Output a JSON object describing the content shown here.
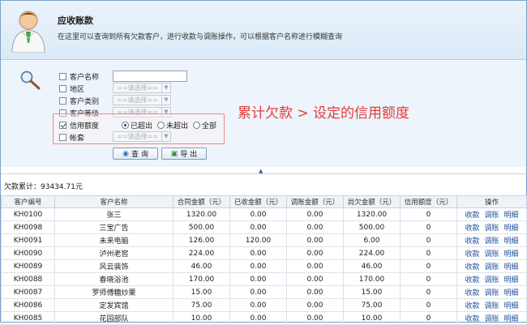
{
  "header": {
    "title": "应收账款",
    "description": "在这里可以查询到所有欠款客户，进行收款与调账操作，可以根据客户名称进行模糊查询"
  },
  "filters": {
    "customer_name_label": "客户名称",
    "region_label": "地区",
    "category_label": "客户类别",
    "level_label": "客户等级",
    "credit_label": "信用额度",
    "account_label": "帐套",
    "select_placeholder": "==请选择==",
    "credit_options": [
      "已超出",
      "未超出",
      "全部"
    ],
    "query_button": "查 询",
    "export_button": "导 出"
  },
  "annotation": "累计欠款 > 设定的信用额度",
  "summary": {
    "total_label": "欠款累计：93434.71元"
  },
  "table": {
    "headers": [
      "客户编号",
      "客户名称",
      "合同金额（元）",
      "已收金额（元）",
      "调账金额（元）",
      "尚欠金额（元）",
      "信用额度（元）",
      "操作"
    ],
    "rows": [
      {
        "code": "KH0100",
        "name": "张三",
        "contract": "1320.00",
        "received": "0.00",
        "adjusted": "0.00",
        "owed": "1320.00",
        "credit": "0"
      },
      {
        "code": "KH0098",
        "name": "三宝广告",
        "contract": "500.00",
        "received": "0.00",
        "adjusted": "0.00",
        "owed": "500.00",
        "credit": "0"
      },
      {
        "code": "KH0091",
        "name": "未来电脑",
        "contract": "126.00",
        "received": "120.00",
        "adjusted": "0.00",
        "owed": "6.00",
        "credit": "0"
      },
      {
        "code": "KH0090",
        "name": "泸州老窖",
        "contract": "224.00",
        "received": "0.00",
        "adjusted": "0.00",
        "owed": "224.00",
        "credit": "0"
      },
      {
        "code": "KH0089",
        "name": "风云装饰",
        "contract": "46.00",
        "received": "0.00",
        "adjusted": "0.00",
        "owed": "46.00",
        "credit": "0"
      },
      {
        "code": "KH0088",
        "name": "春晓浴池",
        "contract": "170.00",
        "received": "0.00",
        "adjusted": "0.00",
        "owed": "170.00",
        "credit": "0"
      },
      {
        "code": "KH0087",
        "name": "罗师傅糖炒栗",
        "contract": "15.00",
        "received": "0.00",
        "adjusted": "0.00",
        "owed": "15.00",
        "credit": "0"
      },
      {
        "code": "KH0086",
        "name": "定发宾馆",
        "contract": "75.00",
        "received": "0.00",
        "adjusted": "0.00",
        "owed": "75.00",
        "credit": "0"
      },
      {
        "code": "KH0085",
        "name": "花园部队",
        "contract": "10.00",
        "received": "0.00",
        "adjusted": "0.00",
        "owed": "10.00",
        "credit": "0"
      }
    ],
    "actions": [
      "收款",
      "调账",
      "明细"
    ]
  },
  "icons": {
    "avatar": "user-avatar-icon",
    "search": "magnifier-icon"
  }
}
